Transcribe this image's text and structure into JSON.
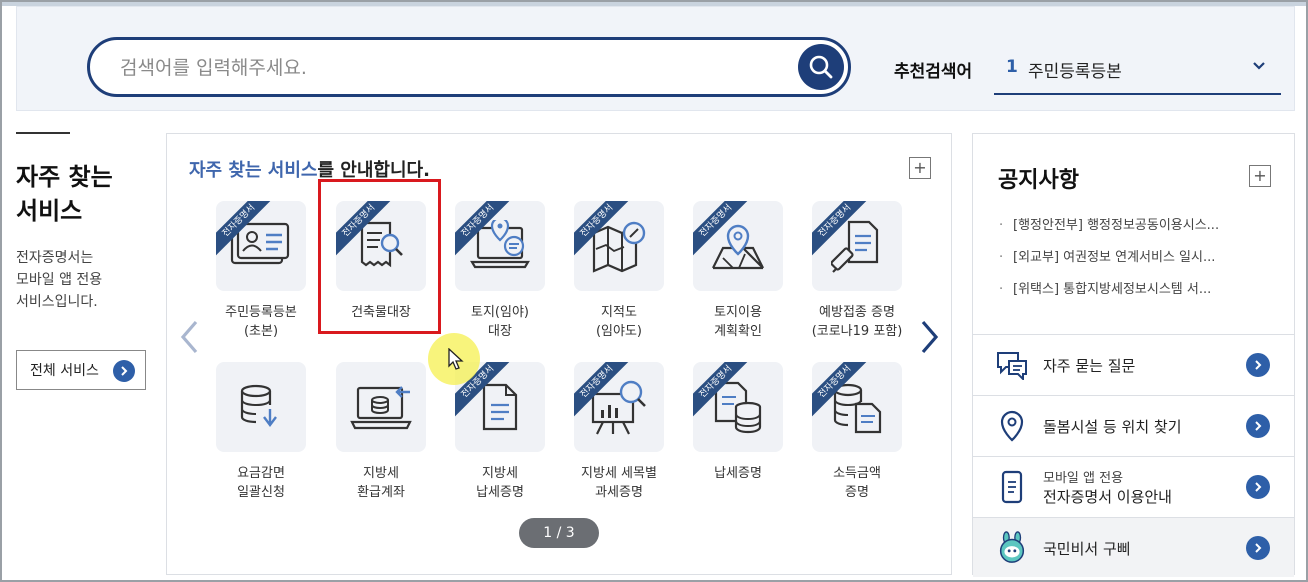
{
  "search": {
    "placeholder": "검색어를 입력해주세요.",
    "recommend_label": "추천검색어",
    "recommend_num": "1",
    "recommend_text": "주민등록등본"
  },
  "left": {
    "title": "자주 찾는\n서비스",
    "desc": "전자증명서는\n모바일 앱 전용\n서비스입니다.",
    "all_button": "전체 서비스"
  },
  "services": {
    "heading_highlight": "자주 찾는 서비스",
    "heading_rest": "를 안내합니다.",
    "ribbon": "전자증명서",
    "pager": "1 / 3",
    "tiles": [
      {
        "label": "주민등록등본\n(초본)",
        "ribbon": true,
        "icon": "id-card-icon"
      },
      {
        "label": "건축물대장",
        "ribbon": true,
        "icon": "document-search-icon"
      },
      {
        "label": "토지(임야)\n대장",
        "ribbon": true,
        "icon": "laptop-location-icon"
      },
      {
        "label": "지적도\n(임야도)",
        "ribbon": true,
        "icon": "map-compass-icon"
      },
      {
        "label": "토지이용\n계획확인",
        "ribbon": true,
        "icon": "map-pin-icon"
      },
      {
        "label": "예방접종 증명\n(코로나19 포함)",
        "ribbon": true,
        "icon": "syringe-document-icon"
      },
      {
        "label": "요금감면\n일괄신청",
        "ribbon": false,
        "icon": "database-download-icon"
      },
      {
        "label": "지방세\n환급계좌",
        "ribbon": false,
        "icon": "laptop-database-icon"
      },
      {
        "label": "지방세\n납세증명",
        "ribbon": true,
        "icon": "document-icon"
      },
      {
        "label": "지방세 세목별\n과세증명",
        "ribbon": true,
        "icon": "presentation-search-icon"
      },
      {
        "label": "납세증명",
        "ribbon": true,
        "icon": "document-database-icon"
      },
      {
        "label": "소득금액\n증명",
        "ribbon": true,
        "icon": "database-document-icon"
      }
    ]
  },
  "notice": {
    "title": "공지사항",
    "items": [
      "[행정안전부] 행정정보공동이용시스...",
      "[외교부] 여권정보 연계서비스 일시...",
      "[위택스] 통합지방세정보시스템 서..."
    ],
    "quick": [
      {
        "label": "자주 묻는 질문",
        "icon": "chat-bubbles-icon"
      },
      {
        "label": "돌봄시설 등 위치 찾기",
        "icon": "location-pin-icon"
      },
      {
        "line1": "모바일 앱 전용",
        "line2": "전자증명서 이용안내",
        "icon": "mobile-phone-icon"
      },
      {
        "label": "국민비서 구삐",
        "icon": "gubbi-mascot-icon"
      }
    ]
  }
}
